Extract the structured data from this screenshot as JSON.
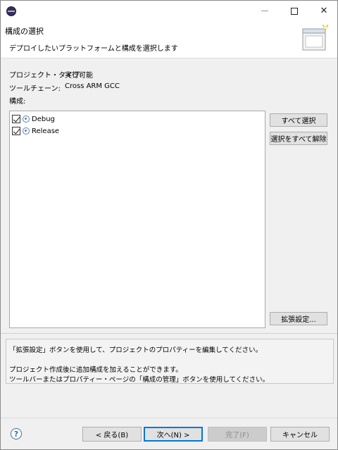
{
  "window": {
    "minimize_label": "",
    "maximize_label": "",
    "close_label": "✕"
  },
  "banner": {
    "title": "構成の選択",
    "description": "デプロイしたいプラットフォームと構成を選択します"
  },
  "info": {
    "project_type_label": "プロジェクト・タイプ:",
    "project_type_value": "実行可能",
    "toolchain_label": "ツールチェーン:",
    "toolchain_value": "Cross ARM GCC",
    "configs_label": "構成:"
  },
  "configurations": [
    {
      "label": "Debug",
      "checked": true
    },
    {
      "label": "Release",
      "checked": true
    }
  ],
  "side_buttons": {
    "select_all": "すべて選択",
    "deselect_all": "選択をすべて解除",
    "advanced": "拡張設定..."
  },
  "messages": {
    "line1": "「拡張設定」ボタンを使用して、プロジェクトのプロパティーを編集してください。",
    "line2": "プロジェクト作成後に追加構成を加えることができます。",
    "line3": "ツールバーまたはプロパティー・ページの「構成の管理」ボタンを使用してください。"
  },
  "footer": {
    "help_icon_text": "?",
    "back": "< 戻る(B)",
    "next": "次へ(N) >",
    "finish": "完了(F)",
    "cancel": "キャンセル"
  }
}
